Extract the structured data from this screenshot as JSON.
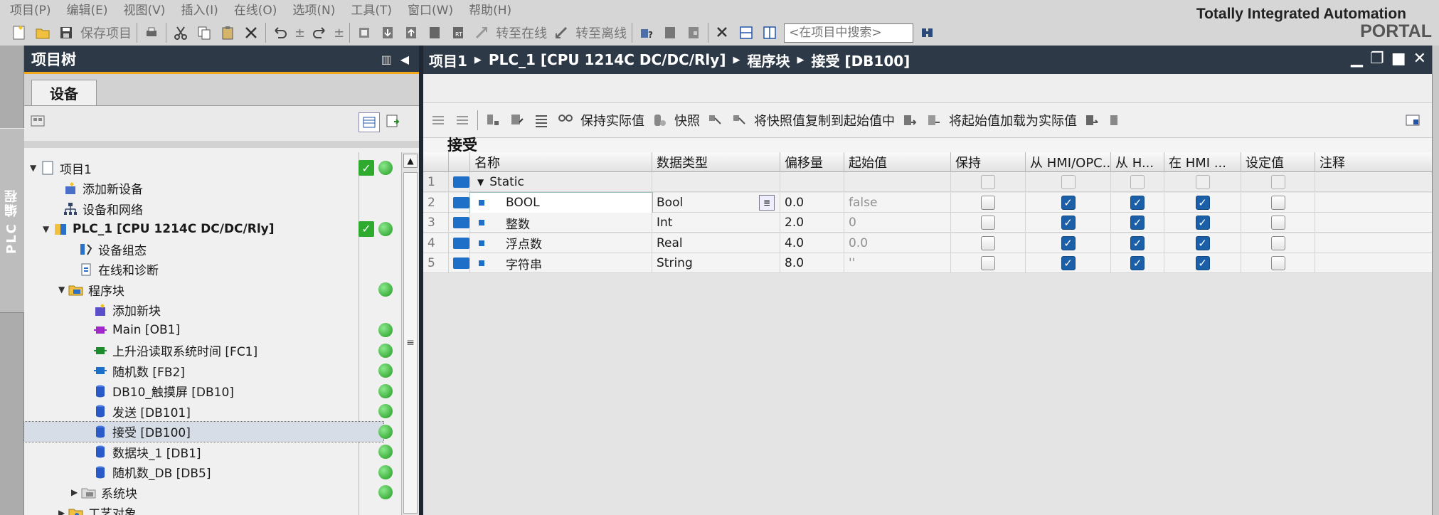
{
  "menubar": {
    "items": [
      "项目(P)",
      "编辑(E)",
      "视图(V)",
      "插入(I)",
      "在线(O)",
      "选项(N)",
      "工具(T)",
      "窗口(W)",
      "帮助(H)"
    ]
  },
  "toolbar": {
    "save_label": "保存项目",
    "go_online_label": "转至在线",
    "go_offline_label": "转至离线",
    "search_placeholder": "<在项目中搜索>"
  },
  "brand": {
    "line1": "Totally Integrated Automation",
    "line2": "PORTAL"
  },
  "sidebar_vertical_tab": "PLC 编程",
  "project_tree": {
    "title": "项目树",
    "tab": "设备",
    "items": [
      {
        "label": "项目1",
        "status": "check_dot"
      },
      {
        "label": "添加新设备",
        "status": ""
      },
      {
        "label": "设备和网络",
        "status": ""
      },
      {
        "label": "PLC_1 [CPU 1214C DC/DC/Rly]",
        "status": "check_dot"
      },
      {
        "label": "设备组态",
        "status": ""
      },
      {
        "label": "在线和诊断",
        "status": ""
      },
      {
        "label": "程序块",
        "status": "dot"
      },
      {
        "label": "添加新块",
        "status": ""
      },
      {
        "label": "Main [OB1]",
        "status": "dot"
      },
      {
        "label": "上升沿读取系统时间 [FC1]",
        "status": "dot"
      },
      {
        "label": "随机数 [FB2]",
        "status": "dot"
      },
      {
        "label": "DB10_触摸屏 [DB10]",
        "status": "dot"
      },
      {
        "label": "发送 [DB101]",
        "status": "dot"
      },
      {
        "label": "接受 [DB100]",
        "status": "dot"
      },
      {
        "label": "数据块_1 [DB1]",
        "status": "dot"
      },
      {
        "label": "随机数_DB [DB5]",
        "status": "dot"
      },
      {
        "label": "系统块",
        "status": "dot"
      },
      {
        "label": "工艺对象",
        "status": ""
      }
    ]
  },
  "editor": {
    "breadcrumb": [
      "项目1",
      "PLC_1 [CPU 1214C DC/DC/Rly]",
      "程序块",
      "接受 [DB100]"
    ],
    "toolbar": {
      "keep_actual": "保持实际值",
      "snapshot": "快照",
      "copy_snapshot": "将快照值复制到起始值中",
      "load_start": "将起始值加载为实际值"
    },
    "block_name": "接受",
    "columns": [
      "名称",
      "数据类型",
      "偏移量",
      "起始值",
      "保持",
      "从 HMI/OPC...",
      "从 H...",
      "在 HMI ...",
      "设定值",
      "注释"
    ],
    "rows": [
      {
        "num": "1",
        "name": "Static",
        "type": "",
        "offset": "",
        "start": "",
        "retain": false,
        "hmi1": false,
        "hmi2": false,
        "hmi3": false,
        "setpoint": false,
        "disabled": true
      },
      {
        "num": "2",
        "name": "BOOL",
        "type": "Bool",
        "offset": "0.0",
        "start": "false",
        "retain": false,
        "hmi1": true,
        "hmi2": true,
        "hmi3": true,
        "setpoint": false,
        "disabled": false
      },
      {
        "num": "3",
        "name": "整数",
        "type": "Int",
        "offset": "2.0",
        "start": "0",
        "retain": false,
        "hmi1": true,
        "hmi2": true,
        "hmi3": true,
        "setpoint": false,
        "disabled": false
      },
      {
        "num": "4",
        "name": "浮点数",
        "type": "Real",
        "offset": "4.0",
        "start": "0.0",
        "retain": false,
        "hmi1": true,
        "hmi2": true,
        "hmi3": true,
        "setpoint": false,
        "disabled": false
      },
      {
        "num": "5",
        "name": "字符串",
        "type": "String",
        "offset": "8.0",
        "start": "''",
        "retain": false,
        "hmi1": true,
        "hmi2": true,
        "hmi3": true,
        "setpoint": false,
        "disabled": false
      }
    ]
  },
  "colors": {
    "header_bg": "#2e3947",
    "accent_orange": "#f0a91a",
    "checkbox_blue": "#1a5fa8",
    "status_green": "#2eaa2e"
  }
}
